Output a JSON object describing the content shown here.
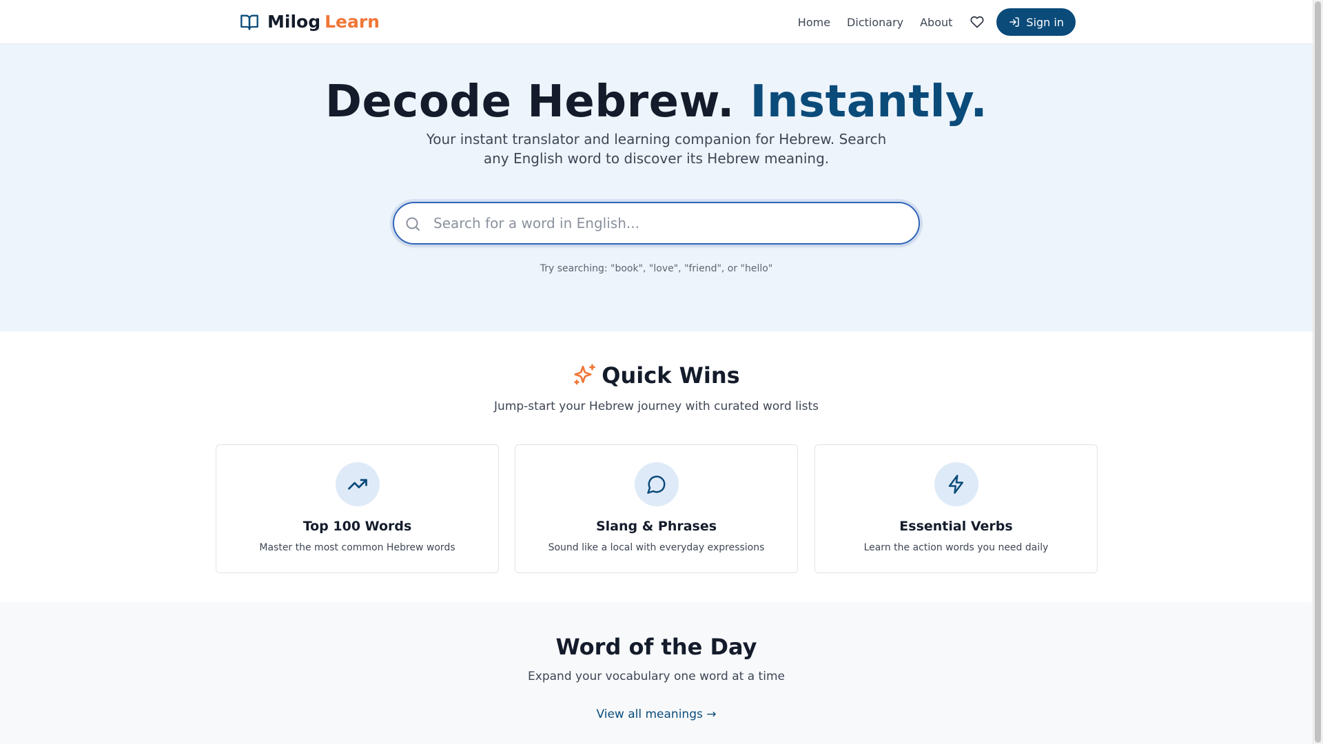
{
  "brand": {
    "name": "Milog",
    "accent": "Learn",
    "icon": "book-open-icon",
    "colors": {
      "primary": "#0b4b7a",
      "accent": "#f07637",
      "hero_bg": "#edf4fb",
      "search_border": "#2f63b8"
    }
  },
  "nav": {
    "links": [
      "Home",
      "Dictionary",
      "About"
    ],
    "favorites_icon": "heart-icon",
    "signin_icon": "sign-in-icon",
    "signin_label": "Sign in"
  },
  "hero": {
    "title_main": "Decode Hebrew.",
    "title_accent": "Instantly.",
    "subtitle": "Your instant translator and learning companion for Hebrew. Search any English word to discover its Hebrew meaning.",
    "search": {
      "icon": "search-icon",
      "placeholder": "Search for a word in English...",
      "value": ""
    },
    "hint": "Try searching: \"book\", \"love\", \"friend\", or \"hello\""
  },
  "quick_wins": {
    "icon": "sparkles-icon",
    "title": "Quick Wins",
    "subtitle": "Jump-start your Hebrew journey with curated word lists",
    "cards": [
      {
        "icon": "trending-up-icon",
        "title": "Top 100 Words",
        "description": "Master the most common Hebrew words"
      },
      {
        "icon": "message-circle-icon",
        "title": "Slang & Phrases",
        "description": "Sound like a local with everyday expressions"
      },
      {
        "icon": "zap-icon",
        "title": "Essential Verbs",
        "description": "Learn the action words you need daily"
      }
    ]
  },
  "word_of_the_day": {
    "title": "Word of the Day",
    "subtitle": "Expand your vocabulary one word at a time",
    "link_label": "View all meanings →"
  }
}
